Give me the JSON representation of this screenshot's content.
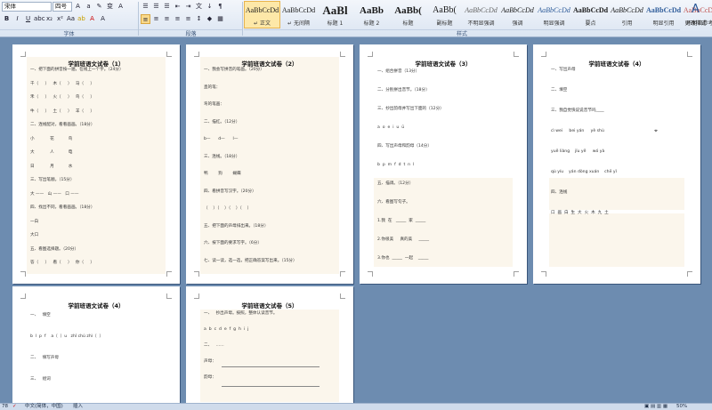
{
  "ribbon": {
    "font_name": "宋体",
    "font_size": "四号",
    "groups": {
      "font": "字体",
      "paragraph": "段落",
      "styles": "样式"
    },
    "styles": [
      {
        "sample": "AaBbCcDd",
        "name": "↵ 正文"
      },
      {
        "sample": "AaBbCcDd",
        "name": "↵ 无间隔"
      },
      {
        "sample": "AaBl",
        "name": "标题 1"
      },
      {
        "sample": "AaBb",
        "name": "标题 2"
      },
      {
        "sample": "AaBb(",
        "name": "标题"
      },
      {
        "sample": "AaBb(",
        "name": "副标题"
      },
      {
        "sample": "AaBbCcDd",
        "name": "不明显强调"
      },
      {
        "sample": "AaBbCcDd",
        "name": "强调"
      },
      {
        "sample": "AaBbCcDd",
        "name": "明显强调"
      },
      {
        "sample": "AaBbCcDd",
        "name": "要点"
      },
      {
        "sample": "AaBbCcDd",
        "name": "引用"
      },
      {
        "sample": "AaBbCcDd",
        "name": "明显引用"
      },
      {
        "sample": "AaBbCcDd",
        "name": "不明显参考"
      },
      {
        "sample": "AaBbCcDd",
        "name": "明显参考"
      }
    ],
    "change_styles": "更改样式"
  },
  "status": {
    "page": "78",
    "language": "中文(简体，中国)",
    "mode": "插入",
    "zoom": "50%"
  },
  "pages": [
    {
      "title": "学前班语文试卷（1）",
      "lines": [
        "一、把下面的拼音按一遍，在线上一个字。（24分）",
        "千（     ）   木（     ）   马（     ）",
        "禾（     ）   火（     ）   鸟（     ）",
        "牛（     ）   土（     ）   羊（     ）",
        "二、连线配对，看看画画。（18分）",
        "小            花           鸟",
        "大            人           电",
        "日            月           水",
        "三、写出笔顺。（15分）",
        "大 ——   山 ——   口 ——",
        "四、找出不同，看看画画。（18分）",
        "一白",
        "大口",
        "五、看图选择题。（20分）",
        "答（     ）   看（     ）   你（     ）"
      ]
    },
    {
      "title": "学前班语文试卷（2）",
      "lines": [
        "一、我会写拼音的笔画。（20分）",
        "直的笔：",
        "弯的笔画：",
        "二、描红。（12分）",
        "b—      d—      l—",
        "三、连线。（18分）",
        "鸭        狗        蝴蝶",
        "四、看拼音写汉字。（20分）",
        "（    ）（    ）（    ）（    ）",
        "五、把下面的声母排出来。（18分）",
        "六、按下面的要求写字。（6分）",
        "七、读一读，选一选，把正确答案写出来。（15分）"
      ]
    },
    {
      "title": "学前班语文试卷（3）",
      "lines": [
        "一、组合拼音（13分）",
        "二、分别拼出音节。（18分）",
        "三、抄出韵母并写出下面的（12分）",
        "a  o  e  i  u  ü",
        "四、写出声母和韵母（14分）",
        "b  p  m  f  d  t  n  l",
        "五、描调。（12分）",
        "六、看图写句子。",
        "1.我  在   _____  家  _____",
        "2.你很美     真的美     _____",
        "3.你也  _____  一起    _____"
      ]
    },
    {
      "title": "学前班语文试卷（4）",
      "lines": [
        "一、写出声母",
        "二、填空",
        "三、我自觉快说说音节吗____",
        "cì wei     bei yán     yè shù",
        "yuě liàng    jǐu yě     wó yà",
        "qù yíu    yán dòng xuán    chē yǐ",
        "四、连线",
        "口  画  白  生  大  火  木  九  土"
      ]
    },
    {
      "title": "学前班语文试卷（4）",
      "lines": [
        "一、   填空",
        "b  l  p  f    a（  ）u   zhǐ chú zhì（  ）",
        "二、   填写声母",
        "三、   组词"
      ]
    },
    {
      "title": "学前班语文试卷（5）",
      "lines": [
        "一、   抄出声母。按照，整体认读音节。",
        "a  b  c  d  e  f  g  h  i  j",
        "二、   ……",
        "声母：",
        "韵母："
      ]
    }
  ]
}
